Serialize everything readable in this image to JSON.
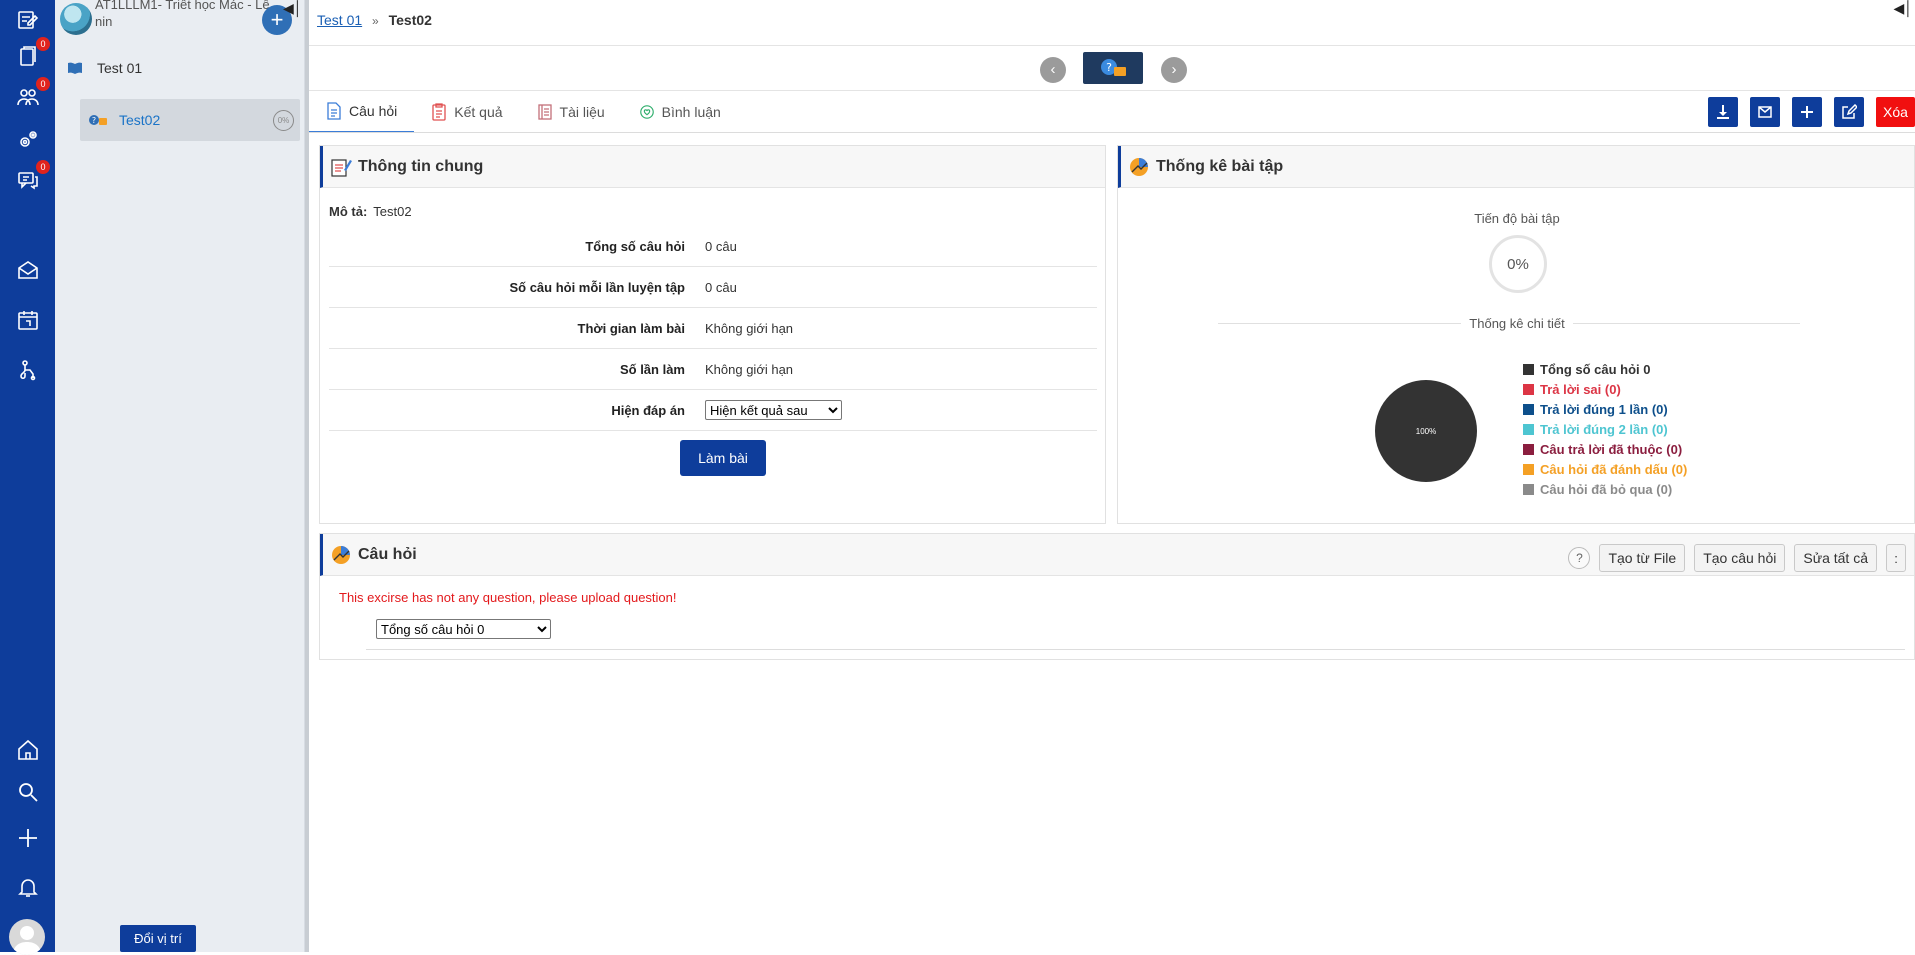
{
  "rail": {
    "badges": {
      "exercises": "0",
      "groups": "0",
      "messages": "0"
    }
  },
  "tree": {
    "course_title": "AT1LLLM1- Triết học Mác - Lê nin",
    "add_label": "+",
    "nodes": [
      {
        "label": "Test 01"
      },
      {
        "label": "Test02",
        "progress": "0%"
      }
    ],
    "move_button": "Đổi vị trí"
  },
  "breadcrumb": {
    "parent": "Test 01",
    "separator": "»",
    "current": "Test02"
  },
  "tabs": [
    {
      "label": "Câu hỏi",
      "icon": "document-icon"
    },
    {
      "label": "Kết quả",
      "icon": "result-icon"
    },
    {
      "label": "Tài liệu",
      "icon": "book-icon"
    },
    {
      "label": "Bình luận",
      "icon": "comment-icon"
    }
  ],
  "toolbar": {
    "delete_label": "Xóa"
  },
  "info": {
    "title": "Thông tin chung",
    "desc_label": "Mô tả:",
    "desc_value": "Test02",
    "rows": [
      {
        "label": "Tổng số câu hỏi",
        "value": "0 câu"
      },
      {
        "label": "Số câu hỏi mỗi lần luyện tập",
        "value": "0 câu"
      },
      {
        "label": "Thời gian làm bài",
        "value": "Không giới hạn"
      },
      {
        "label": "Số lần làm",
        "value": "Không giới hạn"
      },
      {
        "label": "Hiện đáp án",
        "select_value": "Hiện kết quả sau"
      }
    ],
    "do_button": "Làm bài"
  },
  "stats": {
    "title": "Thống kê bài tập",
    "progress_label": "Tiến độ bài tập",
    "progress_value": "0%",
    "detail_label": "Thống kê chi tiết",
    "pie_label": "100%",
    "pie_color": "#333333",
    "legend": [
      {
        "label": "Tổng số câu hỏi 0",
        "color": "#333333"
      },
      {
        "label": "Trả lời sai (0)",
        "color": "#dc3545"
      },
      {
        "label": "Trả lời đúng 1 lần (0)",
        "color": "#0d4f8b"
      },
      {
        "label": "Trả lời đúng 2 lần (0)",
        "color": "#4ec5d1"
      },
      {
        "label": "Câu trả lời đã thuộc (0)",
        "color": "#8b1e3f"
      },
      {
        "label": "Câu hỏi đã đánh dấu (0)",
        "color": "#f4a025"
      },
      {
        "label": "Câu hỏi đã bỏ qua (0)",
        "color": "#8a8a8a"
      }
    ]
  },
  "questions": {
    "title": "Câu hỏi",
    "help": "?",
    "create_from_file": "Tạo từ File",
    "create_question": "Tạo câu hỏi",
    "edit_all": "Sửa tất cả",
    "more": ":",
    "empty_message": "This excirse has not any question, please upload question!",
    "filter_value": "Tổng số câu hỏi 0"
  },
  "colors": {
    "primary": "#0e3d9b",
    "danger": "#f10f0f"
  }
}
